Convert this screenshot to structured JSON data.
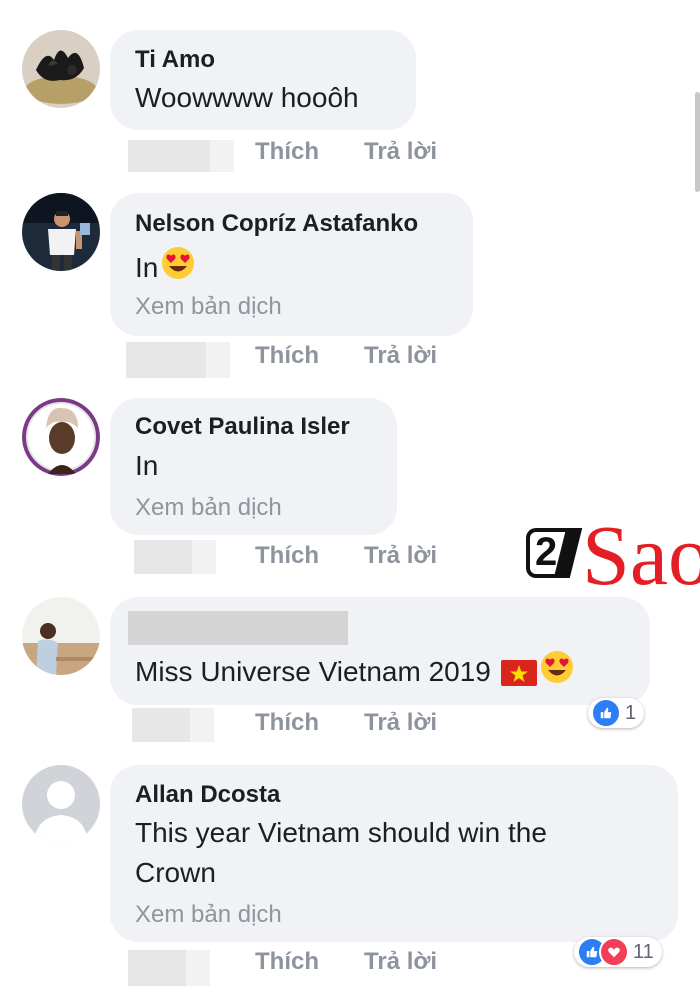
{
  "actions": {
    "like_label": "Thích",
    "reply_label": "Trả lời"
  },
  "translate_label": "Xem bản dịch",
  "watermark": {
    "number": "2",
    "text": "Sao"
  },
  "comments": [
    {
      "name": "Ti Amo",
      "text": "Woowwww hooôh"
    },
    {
      "name": "Nelson Copríz Astafanko",
      "text": "In"
    },
    {
      "name": "Covet Paulina Isler",
      "text": "In"
    },
    {
      "name": "",
      "text": "Miss Universe Vietnam 2019",
      "reactions": {
        "count": "1"
      }
    },
    {
      "name": "Allan Dcosta",
      "text_line1": "This year Vietnam should win the",
      "text_line2": "Crown",
      "reactions": {
        "count": "11"
      }
    }
  ]
}
